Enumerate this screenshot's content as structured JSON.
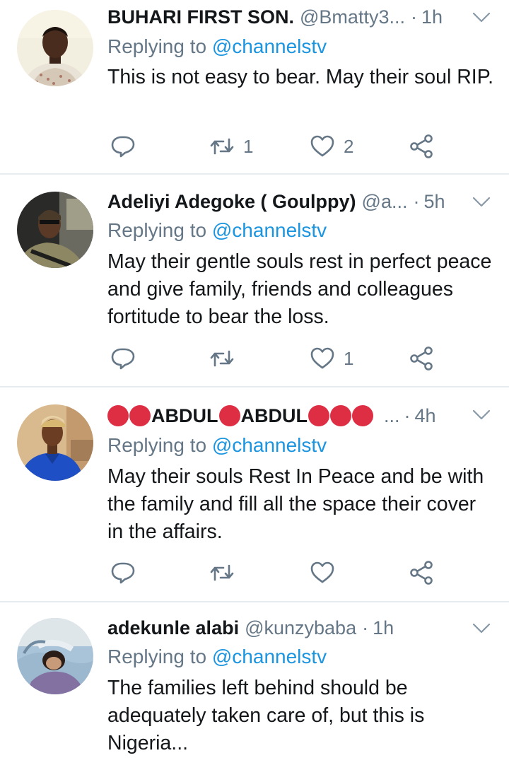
{
  "colors": {
    "name": "#14171a",
    "muted": "#657786",
    "link": "#1b95e0",
    "divider": "#e6ecf0",
    "red_circle": "#dd2e44"
  },
  "tweets": [
    {
      "name": "BUHARI FIRST SON.",
      "handle": "@Bmatty3...",
      "sep": "·",
      "time": "1h",
      "reply_prefix": "Replying to",
      "reply_to": "@channelstv",
      "text": "This is not easy to bear. May their soul RIP.",
      "retweets": "1",
      "likes": "2"
    },
    {
      "name": "Adeliyi Adegoke ( Goulppy)",
      "handle": "@a...",
      "sep": "·",
      "time": "5h",
      "reply_prefix": "Replying to",
      "reply_to": "@channelstv",
      "text": "May their gentle souls rest in perfect peace and give family, friends and colleagues fortitude to bear the loss.",
      "retweets": "",
      "likes": "1"
    },
    {
      "name_parts": [
        "ABDUL",
        "ABDUL"
      ],
      "handle": "...",
      "sep": "·",
      "time": "4h",
      "reply_prefix": "Replying to",
      "reply_to": "@channelstv",
      "text": "May their souls Rest In Peace and be with the family and fill all the space their cover in the affairs.",
      "retweets": "",
      "likes": ""
    },
    {
      "name": "adekunle alabi",
      "handle": "@kunzybaba",
      "sep": "·",
      "time": "1h",
      "reply_prefix": "Replying to",
      "reply_to": "@channelstv",
      "text": "The families left behind should be adequately taken care of, but this is Nigeria..."
    }
  ],
  "icons": {
    "reply": "reply-icon",
    "retweet": "retweet-icon",
    "like": "heart-icon",
    "share": "share-icon",
    "more": "chevron-down-icon"
  }
}
